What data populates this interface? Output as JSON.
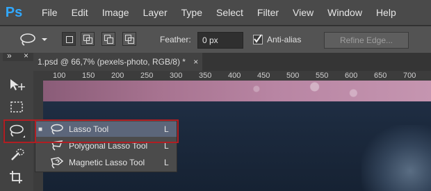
{
  "app": {
    "logo": "Ps"
  },
  "menu": [
    "File",
    "Edit",
    "Image",
    "Layer",
    "Type",
    "Select",
    "Filter",
    "View",
    "Window",
    "Help"
  ],
  "options": {
    "feather_label": "Feather:",
    "feather_value": "0 px",
    "antialias_label": "Anti-alias",
    "antialias_checked": true,
    "refine_edge_label": "Refine Edge..."
  },
  "toolbox": {
    "collapse_glyph": "»",
    "close_glyph": "×",
    "tools": [
      "move-tool",
      "marquee-tool",
      "lasso-tool",
      "quick-selection-tool",
      "crop-tool"
    ]
  },
  "document": {
    "tab_title": "1.psd @ 66,7% (pexels-photo, RGB/8) *",
    "tab_close": "×"
  },
  "ruler": {
    "labels": [
      "100",
      "150",
      "200",
      "250",
      "300",
      "350",
      "400",
      "450",
      "500",
      "550",
      "600",
      "650",
      "700"
    ]
  },
  "flyout": {
    "items": [
      {
        "label": "Lasso Tool",
        "key": "L",
        "selected": true,
        "bullet": "■"
      },
      {
        "label": "Polygonal Lasso Tool",
        "key": "L",
        "selected": false,
        "bullet": ""
      },
      {
        "label": "Magnetic Lasso Tool",
        "key": "L",
        "selected": false,
        "bullet": ""
      }
    ]
  },
  "colors": {
    "highlight": "#b11e23",
    "menubar": "#4a4a4a",
    "selected_item": "#5c667a"
  }
}
